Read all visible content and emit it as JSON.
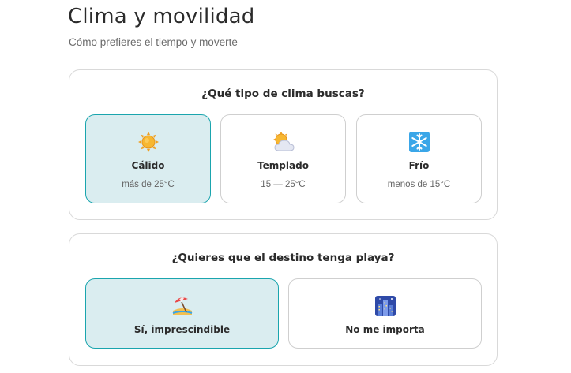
{
  "header": {
    "title": "Clima y movilidad",
    "subtitle": "Cómo prefieres el tiempo y moverte"
  },
  "climate": {
    "question": "¿Qué tipo de clima buscas?",
    "options": [
      {
        "label": "Cálido",
        "detail": "más de 25°C",
        "icon": "sun-icon",
        "selected": true
      },
      {
        "label": "Templado",
        "detail": "15 — 25°C",
        "icon": "sun-behind-cloud-icon",
        "selected": false
      },
      {
        "label": "Frío",
        "detail": "menos de 15°C",
        "icon": "snowflake-icon",
        "selected": false
      }
    ]
  },
  "beach": {
    "question": "¿Quieres que el destino tenga playa?",
    "options": [
      {
        "label": "Sí, imprescindible",
        "icon": "beach-umbrella-icon",
        "selected": true
      },
      {
        "label": "No me importa",
        "icon": "city-icon",
        "selected": false
      }
    ]
  },
  "colors": {
    "selected_bg": "#daedf0",
    "selected_border": "#1aa5ae",
    "card_border": "#d9d9d9"
  }
}
